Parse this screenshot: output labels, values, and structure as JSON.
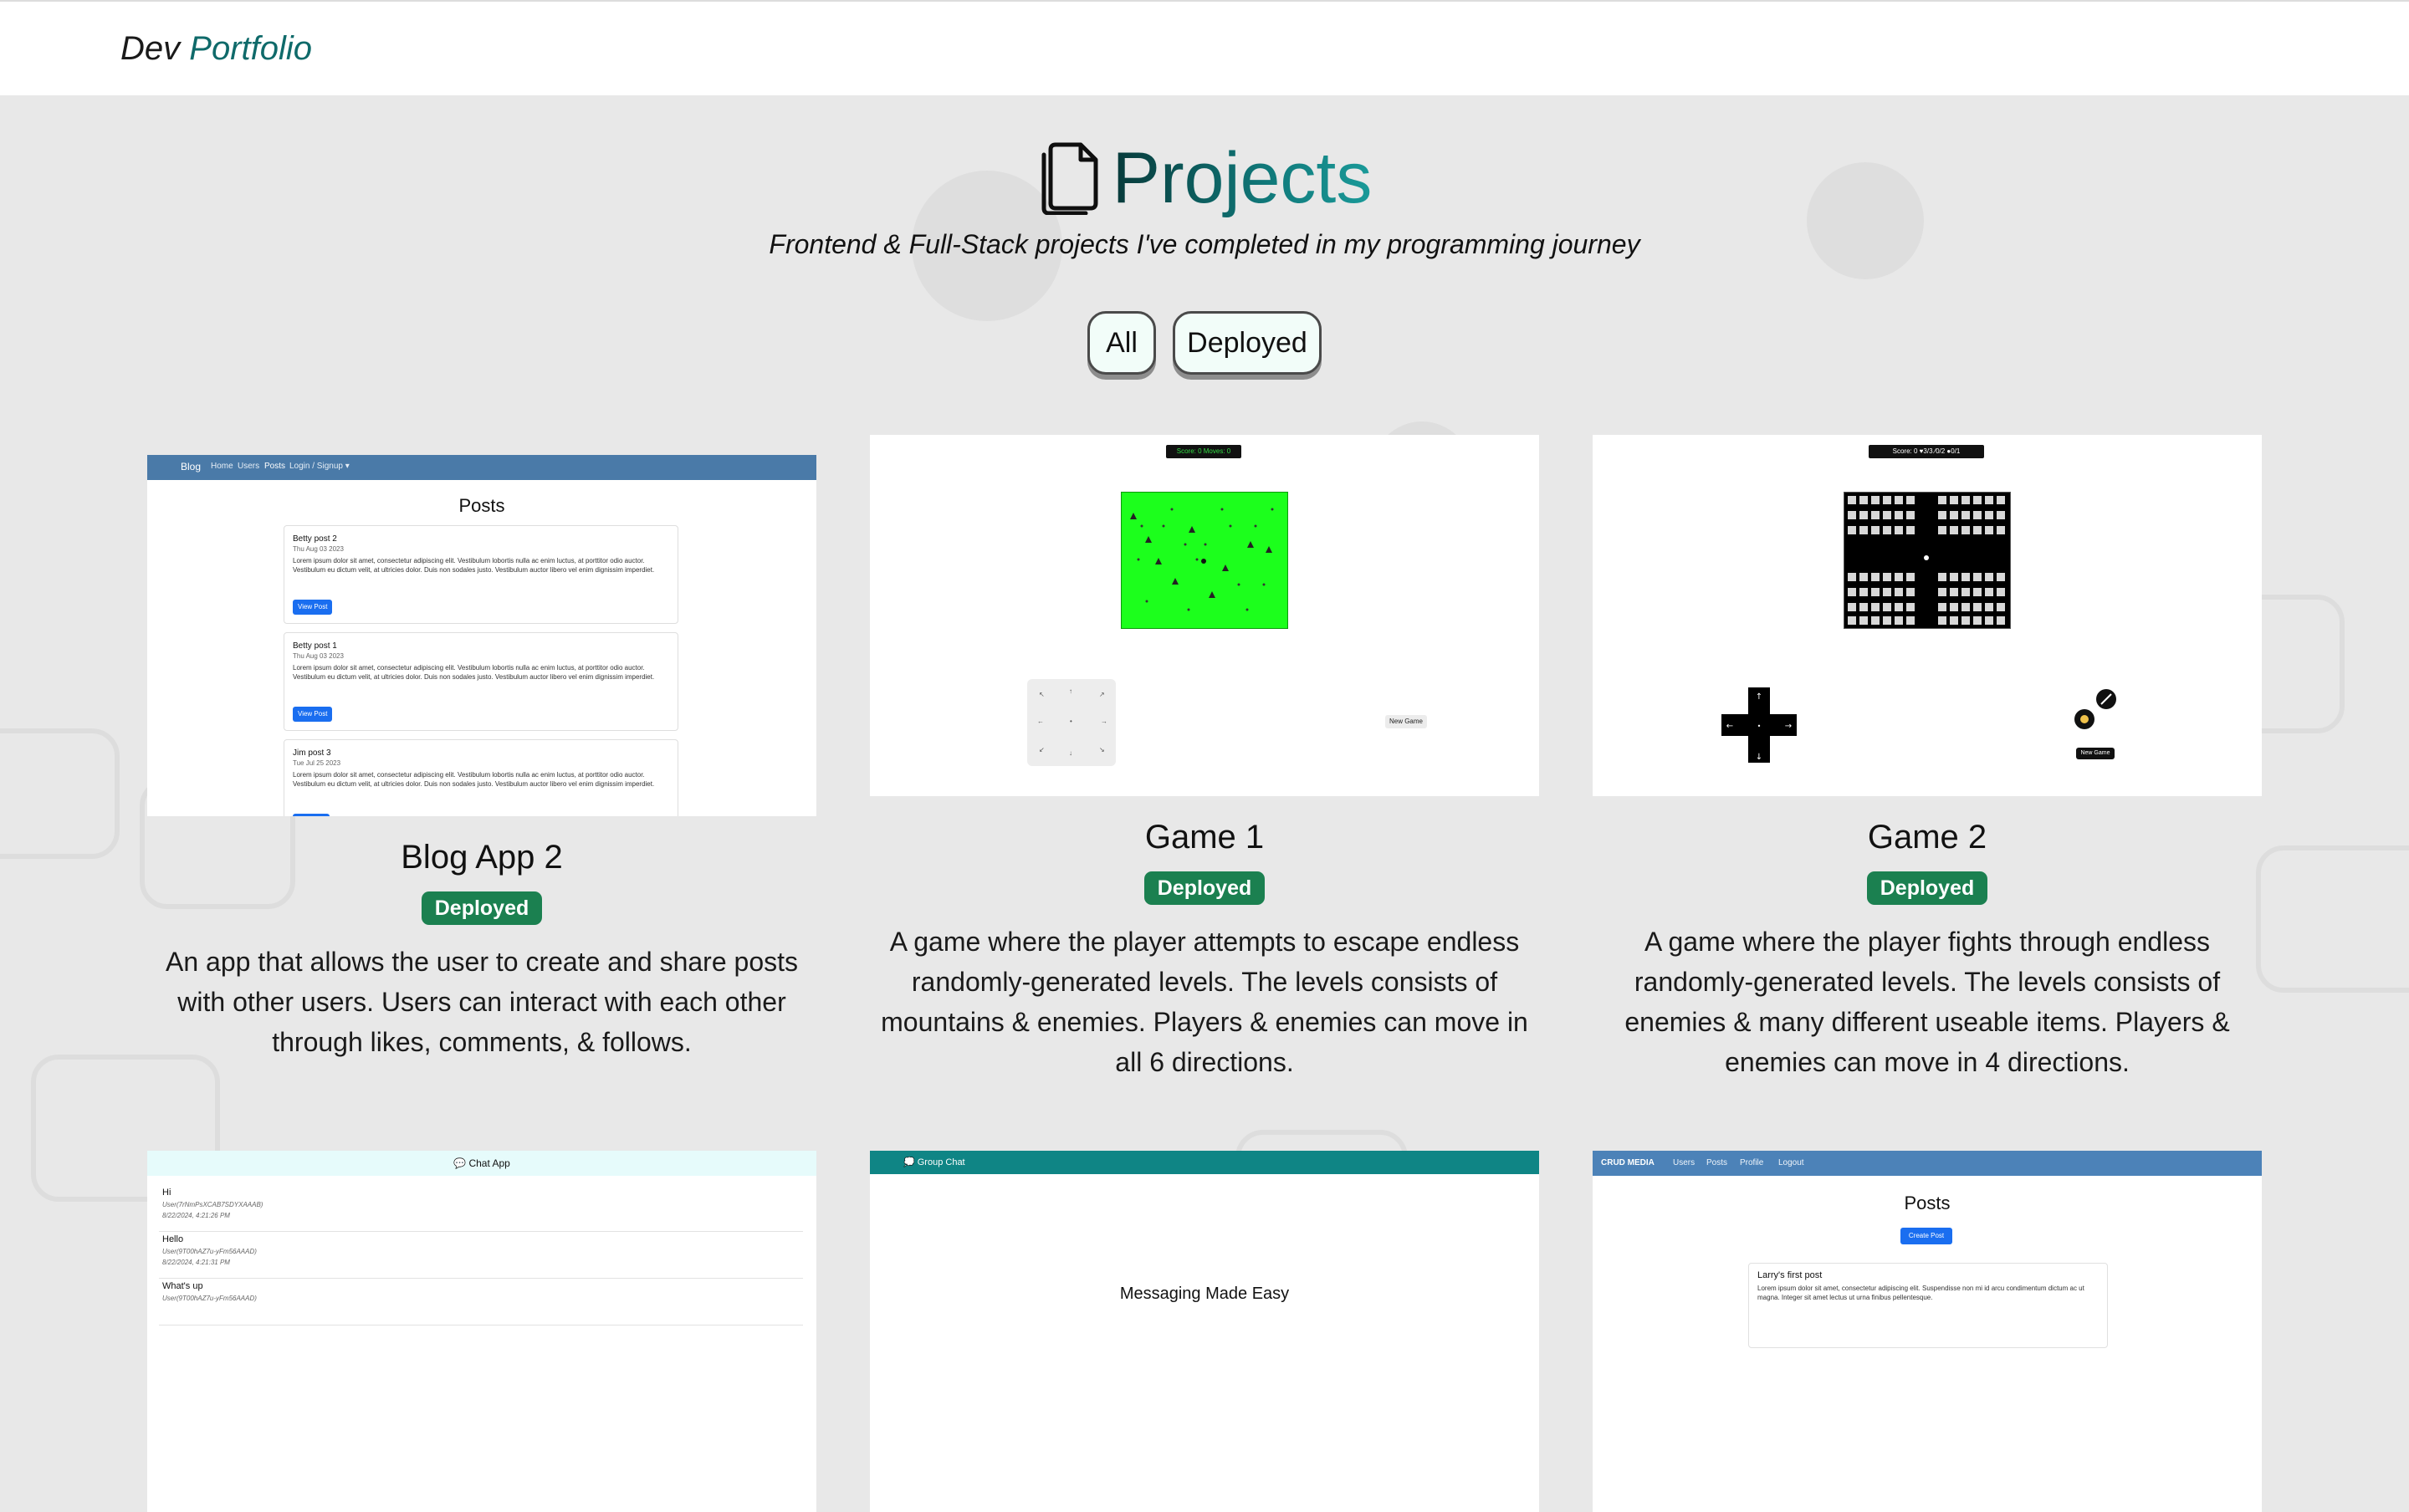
{
  "navbar": {
    "brand_part1": "Dev",
    "brand_part2": "Portfolio"
  },
  "header": {
    "title": "Projects",
    "subtitle": "Frontend & Full-Stack projects I've completed in my programming journey"
  },
  "filters": [
    {
      "label": "All"
    },
    {
      "label": "Deployed"
    }
  ],
  "projects": [
    {
      "title": "Blog App 2",
      "status": "Deployed",
      "description": "An app that allows the user to create and share posts with other users. Users can interact with each other through likes, comments, & follows."
    },
    {
      "title": "Game 1",
      "status": "Deployed",
      "description": "A game where the player attempts to escape endless randomly-generated levels. The levels consists of mountains & enemies. Players & enemies can move in all 6 directions."
    },
    {
      "title": "Game 2",
      "status": "Deployed",
      "description": "A game where the player fights through endless randomly-generated levels. The levels consists of enemies & many different useable items. Players & enemies can move in 4 directions."
    }
  ],
  "blog_thumb": {
    "nav": [
      "Blog",
      "Home",
      "Users",
      "Posts",
      "Login / Signup ▾"
    ],
    "heading": "Posts",
    "posts": [
      {
        "title": "Betty post 2",
        "date": "Thu Aug 03 2023",
        "body": "Lorem ipsum dolor sit amet, consectetur adipiscing elit. Vestibulum lobortis nulla ac enim luctus, at porttitor odio auctor. Vestibulum eu dictum velit, at ultricies dolor. Duis non sodales justo. Vestibulum auctor libero vel enim dignissim imperdiet.",
        "button": "View Post"
      },
      {
        "title": "Betty post 1",
        "date": "Thu Aug 03 2023",
        "body": "Lorem ipsum dolor sit amet, consectetur adipiscing elit. Vestibulum lobortis nulla ac enim luctus, at porttitor odio auctor. Vestibulum eu dictum velit, at ultricies dolor. Duis non sodales justo. Vestibulum auctor libero vel enim dignissim imperdiet.",
        "button": "View Post"
      },
      {
        "title": "Jim post 3",
        "date": "Tue Jul 25 2023",
        "body": "Lorem ipsum dolor sit amet, consectetur adipiscing elit. Vestibulum lobortis nulla ac enim luctus, at porttitor odio auctor. Vestibulum eu dictum velit, at ultricies dolor. Duis non sodales justo. Vestibulum auctor libero vel enim dignissim imperdiet.",
        "button": ""
      }
    ]
  },
  "game1_thumb": {
    "score": "Score: 0    Moves: 0",
    "new_game": "New Game",
    "arrows": [
      "↖",
      "↑",
      "↗",
      "←",
      "•",
      "→",
      "↙",
      "↓",
      "↘"
    ]
  },
  "game2_thumb": {
    "score": "Score: 0  ♥3/3  ⁄0/2  ●0/1",
    "new_game": "New Game",
    "arrows": [
      "↑",
      "←",
      "•",
      "→",
      "↓"
    ]
  },
  "chat_thumb": {
    "header": "💬 Chat App",
    "messages": [
      {
        "text": "Hi",
        "user": "User(7rNmPsXCAB7SDYXAAAB)",
        "date": "8/22/2024, 4:21:26 PM"
      },
      {
        "text": "Hello",
        "user": "User(9T00hAZ7u-yFm56AAAD)",
        "date": "8/22/2024, 4:21:31 PM"
      },
      {
        "text": "What's up",
        "user": "User(9T00hAZ7u-yFm56AAAD)",
        "date": ""
      }
    ]
  },
  "group_thumb": {
    "header": "💭 Group Chat",
    "text": "Messaging Made Easy"
  },
  "crud_thumb": {
    "nav": [
      "CRUD MEDIA",
      "Users",
      "Posts",
      "Profile",
      "Logout"
    ],
    "heading": "Posts",
    "button": "Create Post",
    "post_title": "Larry's first post",
    "post_body": "Lorem ipsum dolor sit amet, consectetur adipiscing elit. Suspendisse non mi id arcu condimentum dictum ac ut magna. Integer sit amet lectus ut urna finibus pellentesque."
  },
  "colors": {
    "brand_teal": "#0f6a6a",
    "badge_green": "#1b8050",
    "background": "#e8e8e8",
    "filter_bg": "#f2fdf9"
  }
}
